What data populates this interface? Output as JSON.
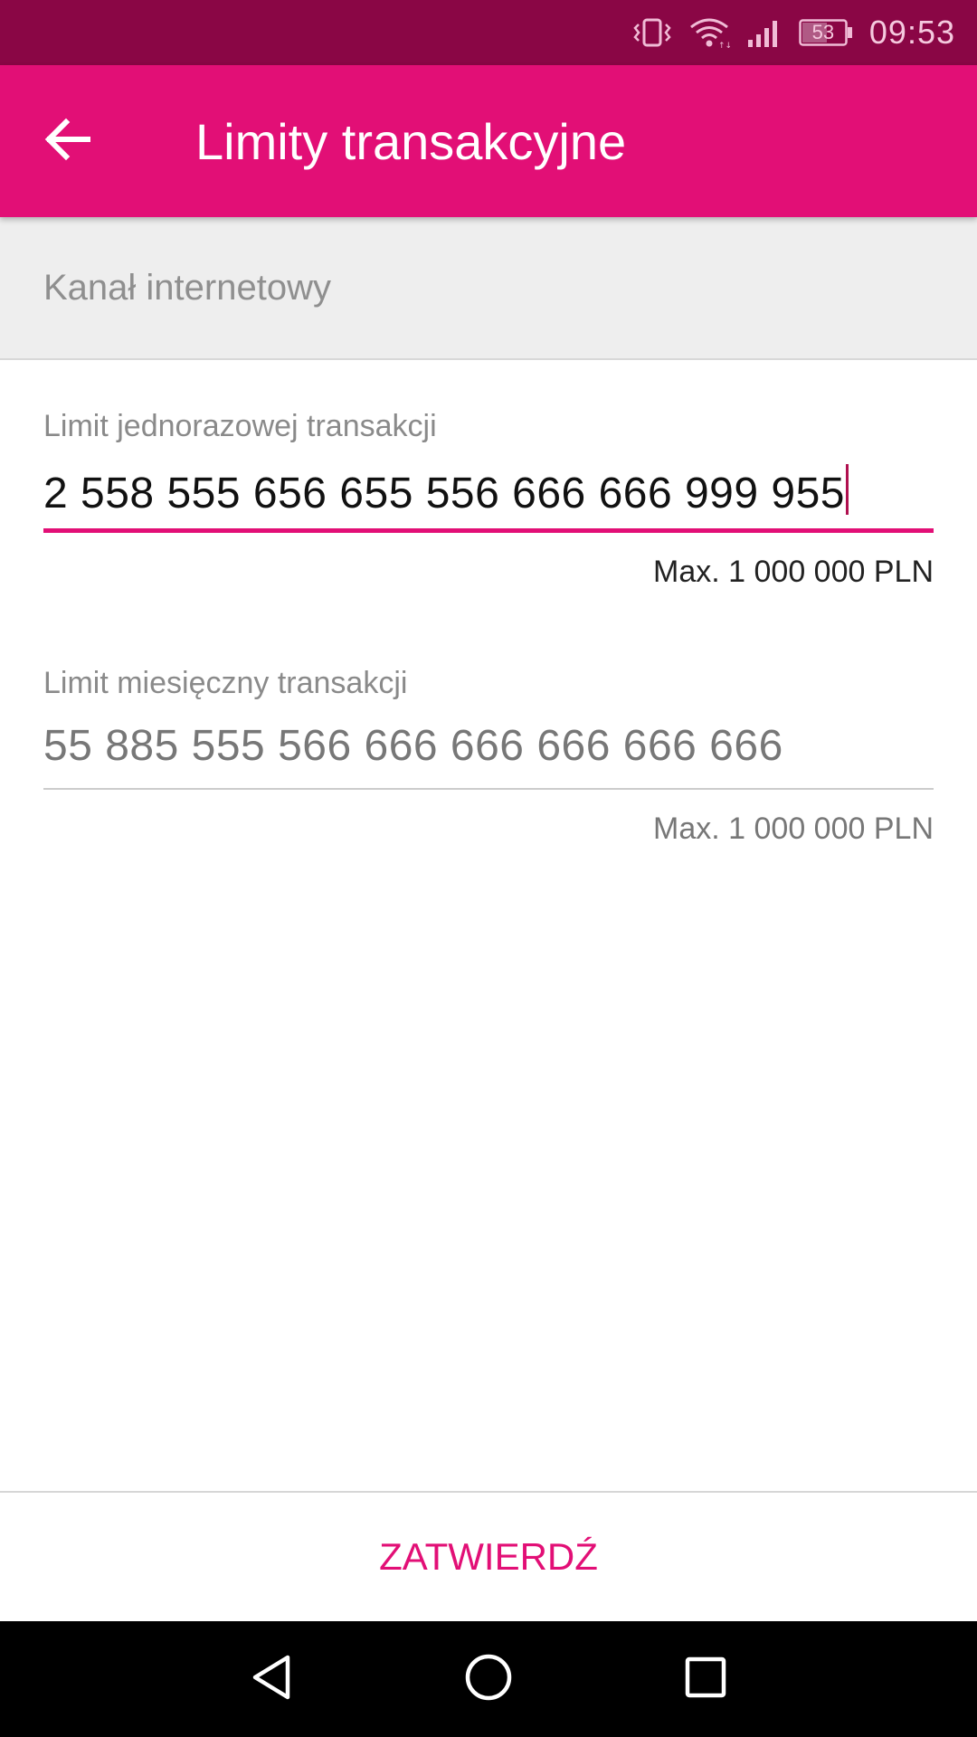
{
  "status_bar": {
    "battery_level": "53",
    "time": "09:53",
    "icons": [
      "vibrate-icon",
      "wifi-icon",
      "signal-icon",
      "battery-icon"
    ]
  },
  "app_bar": {
    "title": "Limity transakcyjne",
    "back_icon": "arrow-back-icon"
  },
  "section": {
    "title": "Kanał internetowy"
  },
  "fields": [
    {
      "label": "Limit jednorazowej transakcji",
      "value": "2 558 555 656 655 556 666 666 999 955",
      "hint": "Max. 1 000 000 PLN",
      "focused": true
    },
    {
      "label": "Limit miesięczny transakcji",
      "value": "55 885 555 566 666 666 666 666 666",
      "hint": "Max. 1 000 000 PLN",
      "focused": false
    }
  ],
  "confirm": {
    "label": "ZATWIERDŹ"
  },
  "colors": {
    "status_bar": "#8a0645",
    "accent": "#e20f76",
    "section_bg": "#eeeeee"
  },
  "nav_bar": {
    "icons": [
      "back-triangle-icon",
      "home-circle-icon",
      "recents-square-icon"
    ]
  }
}
